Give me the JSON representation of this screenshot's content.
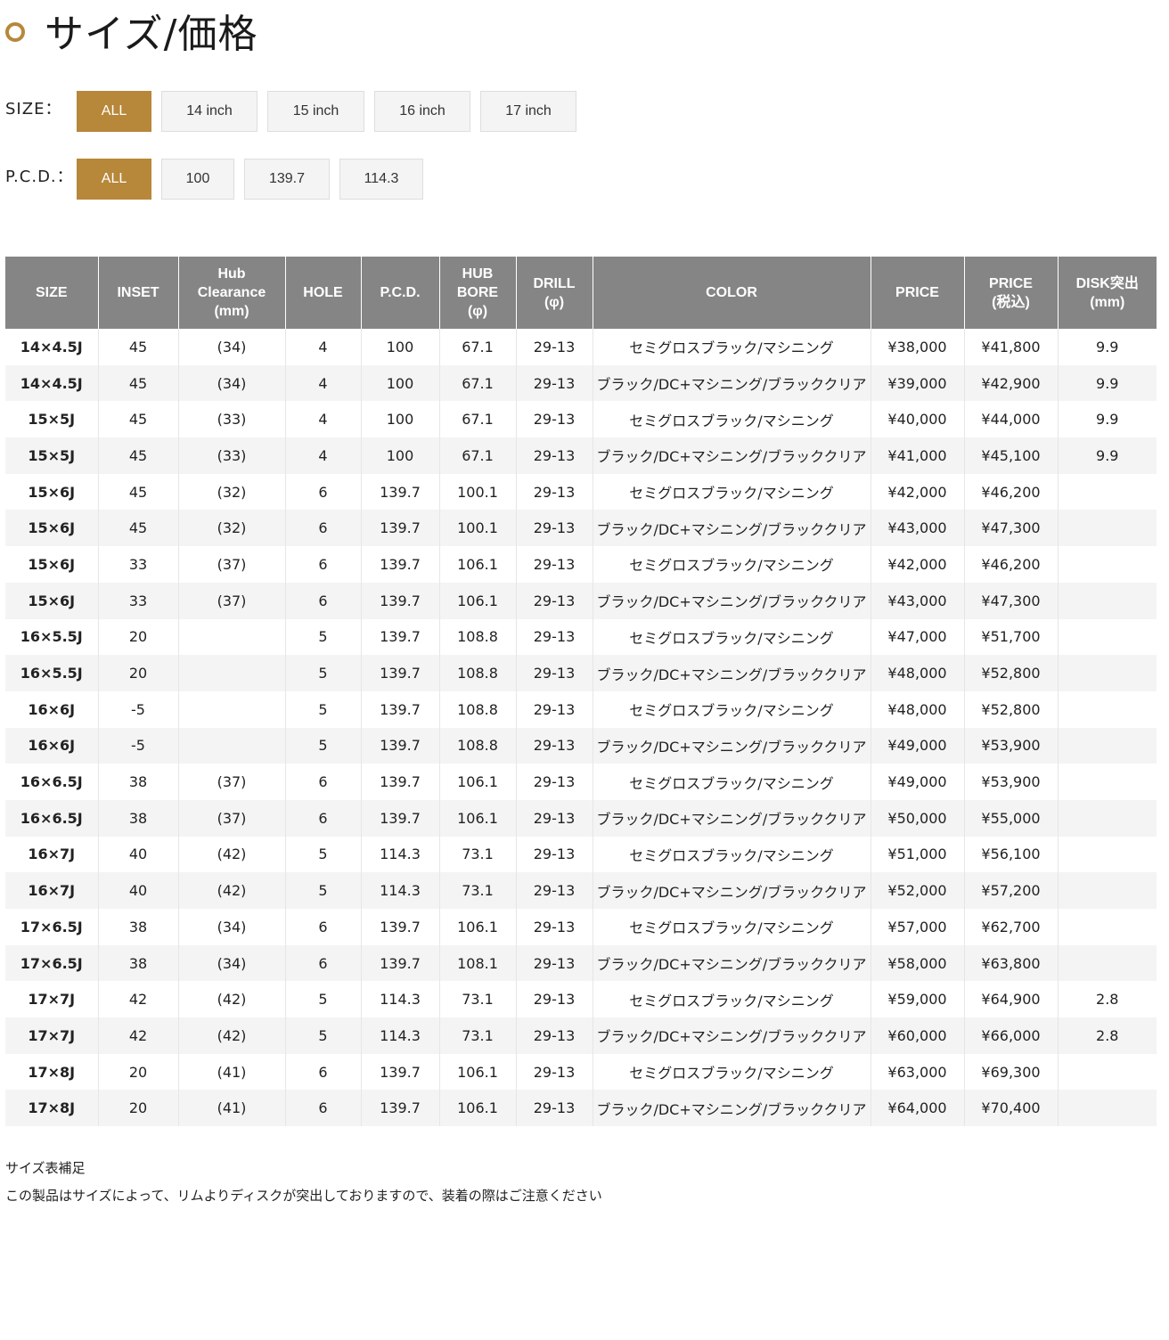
{
  "page": {
    "title": "サイズ/価格"
  },
  "filters": {
    "size": {
      "label": "SIZE：",
      "options": [
        "ALL",
        "14 inch",
        "15 inch",
        "16 inch",
        "17 inch"
      ],
      "selected": "ALL"
    },
    "pcd": {
      "label": "P.C.D.：",
      "options": [
        "ALL",
        "100",
        "139.7",
        "114.3"
      ],
      "selected": "ALL"
    }
  },
  "table": {
    "headers": [
      [
        "SIZE"
      ],
      [
        "INSET"
      ],
      [
        "Hub",
        "Clearance",
        "(mm)"
      ],
      [
        "HOLE"
      ],
      [
        "P.C.D."
      ],
      [
        "HUB",
        "BORE",
        "(φ)"
      ],
      [
        "DRILL",
        "(φ)"
      ],
      [
        "COLOR"
      ],
      [
        "PRICE"
      ],
      [
        "PRICE",
        "(税込)"
      ],
      [
        "DISK突出",
        "(mm)"
      ]
    ],
    "rows": [
      [
        "14×4.5J",
        "45",
        "(34)",
        "4",
        "100",
        "67.1",
        "29-13",
        "セミグロスブラック/マシニング",
        "¥38,000",
        "¥41,800",
        "9.9"
      ],
      [
        "14×4.5J",
        "45",
        "(34)",
        "4",
        "100",
        "67.1",
        "29-13",
        "ブラック/DC+マシニング/ブラッククリア",
        "¥39,000",
        "¥42,900",
        "9.9"
      ],
      [
        "15×5J",
        "45",
        "(33)",
        "4",
        "100",
        "67.1",
        "29-13",
        "セミグロスブラック/マシニング",
        "¥40,000",
        "¥44,000",
        "9.9"
      ],
      [
        "15×5J",
        "45",
        "(33)",
        "4",
        "100",
        "67.1",
        "29-13",
        "ブラック/DC+マシニング/ブラッククリア",
        "¥41,000",
        "¥45,100",
        "9.9"
      ],
      [
        "15×6J",
        "45",
        "(32)",
        "6",
        "139.7",
        "100.1",
        "29-13",
        "セミグロスブラック/マシニング",
        "¥42,000",
        "¥46,200",
        ""
      ],
      [
        "15×6J",
        "45",
        "(32)",
        "6",
        "139.7",
        "100.1",
        "29-13",
        "ブラック/DC+マシニング/ブラッククリア",
        "¥43,000",
        "¥47,300",
        ""
      ],
      [
        "15×6J",
        "33",
        "(37)",
        "6",
        "139.7",
        "106.1",
        "29-13",
        "セミグロスブラック/マシニング",
        "¥42,000",
        "¥46,200",
        ""
      ],
      [
        "15×6J",
        "33",
        "(37)",
        "6",
        "139.7",
        "106.1",
        "29-13",
        "ブラック/DC+マシニング/ブラッククリア",
        "¥43,000",
        "¥47,300",
        ""
      ],
      [
        "16×5.5J",
        "20",
        "",
        "5",
        "139.7",
        "108.8",
        "29-13",
        "セミグロスブラック/マシニング",
        "¥47,000",
        "¥51,700",
        ""
      ],
      [
        "16×5.5J",
        "20",
        "",
        "5",
        "139.7",
        "108.8",
        "29-13",
        "ブラック/DC+マシニング/ブラッククリア",
        "¥48,000",
        "¥52,800",
        ""
      ],
      [
        "16×6J",
        "-5",
        "",
        "5",
        "139.7",
        "108.8",
        "29-13",
        "セミグロスブラック/マシニング",
        "¥48,000",
        "¥52,800",
        ""
      ],
      [
        "16×6J",
        "-5",
        "",
        "5",
        "139.7",
        "108.8",
        "29-13",
        "ブラック/DC+マシニング/ブラッククリア",
        "¥49,000",
        "¥53,900",
        ""
      ],
      [
        "16×6.5J",
        "38",
        "(37)",
        "6",
        "139.7",
        "106.1",
        "29-13",
        "セミグロスブラック/マシニング",
        "¥49,000",
        "¥53,900",
        ""
      ],
      [
        "16×6.5J",
        "38",
        "(37)",
        "6",
        "139.7",
        "106.1",
        "29-13",
        "ブラック/DC+マシニング/ブラッククリア",
        "¥50,000",
        "¥55,000",
        ""
      ],
      [
        "16×7J",
        "40",
        "(42)",
        "5",
        "114.3",
        "73.1",
        "29-13",
        "セミグロスブラック/マシニング",
        "¥51,000",
        "¥56,100",
        ""
      ],
      [
        "16×7J",
        "40",
        "(42)",
        "5",
        "114.3",
        "73.1",
        "29-13",
        "ブラック/DC+マシニング/ブラッククリア",
        "¥52,000",
        "¥57,200",
        ""
      ],
      [
        "17×6.5J",
        "38",
        "(34)",
        "6",
        "139.7",
        "106.1",
        "29-13",
        "セミグロスブラック/マシニング",
        "¥57,000",
        "¥62,700",
        ""
      ],
      [
        "17×6.5J",
        "38",
        "(34)",
        "6",
        "139.7",
        "108.1",
        "29-13",
        "ブラック/DC+マシニング/ブラッククリア",
        "¥58,000",
        "¥63,800",
        ""
      ],
      [
        "17×7J",
        "42",
        "(42)",
        "5",
        "114.3",
        "73.1",
        "29-13",
        "セミグロスブラック/マシニング",
        "¥59,000",
        "¥64,900",
        "2.8"
      ],
      [
        "17×7J",
        "42",
        "(42)",
        "5",
        "114.3",
        "73.1",
        "29-13",
        "ブラック/DC+マシニング/ブラッククリア",
        "¥60,000",
        "¥66,000",
        "2.8"
      ],
      [
        "17×8J",
        "20",
        "(41)",
        "6",
        "139.7",
        "106.1",
        "29-13",
        "セミグロスブラック/マシニング",
        "¥63,000",
        "¥69,300",
        ""
      ],
      [
        "17×8J",
        "20",
        "(41)",
        "6",
        "139.7",
        "106.1",
        "29-13",
        "ブラック/DC+マシニング/ブラッククリア",
        "¥64,000",
        "¥70,400",
        ""
      ]
    ]
  },
  "notes": {
    "heading": "サイズ表補足",
    "body": "この製品はサイズによって、リムよりディスクが突出しておりますので、装着の際はご注意ください"
  },
  "colors": {
    "accent": "#b7873a",
    "header_bg": "#858585",
    "stripe_bg": "#f4f4f4"
  }
}
